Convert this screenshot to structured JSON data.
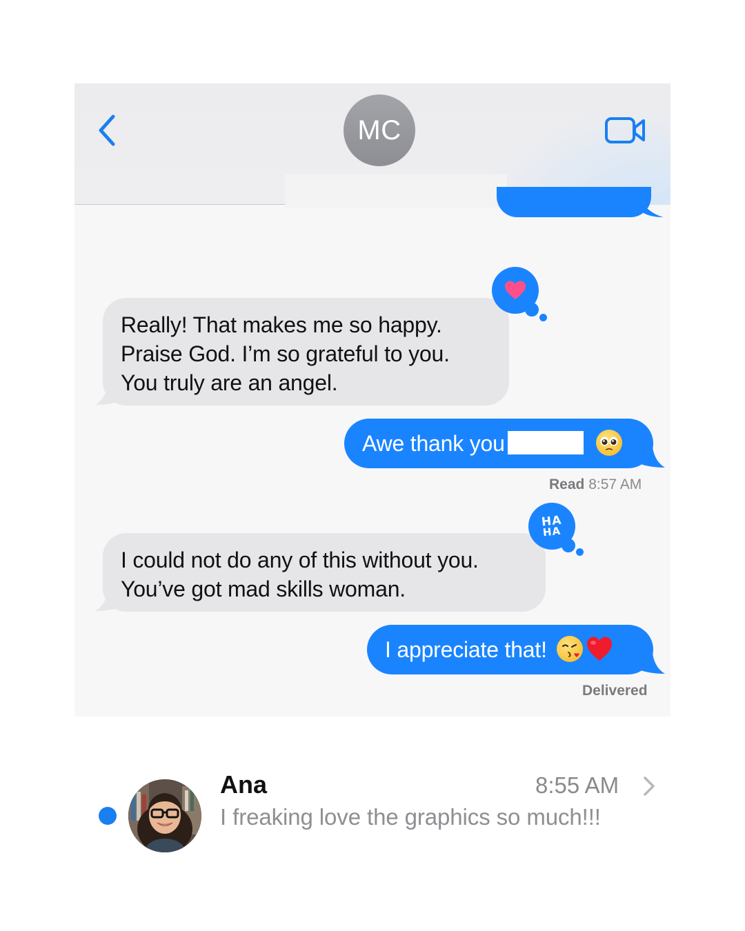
{
  "header": {
    "contact_initials": "MC",
    "back_icon": "chevron-left-icon",
    "video_icon": "video-camera-icon",
    "accent_color": "#1a84ff"
  },
  "messages": [
    {
      "direction": "incoming",
      "lines": [
        "Really! That makes me so happy.",
        "Praise God. I’m so grateful to you.",
        "You truly are an angel."
      ],
      "tapback": "heart"
    },
    {
      "direction": "outgoing",
      "text": "Awe thank you",
      "emoji": "pleading-face-emoji"
    },
    {
      "direction": "incoming",
      "lines": [
        "I could not do any of this without you.",
        "You’ve got mad skills woman."
      ],
      "tapback": "haha",
      "tapback_text": [
        "HA",
        "HA"
      ]
    },
    {
      "direction": "outgoing",
      "text": "I appreciate that!",
      "emoji": [
        "kissing-face-emoji",
        "red-heart-emoji"
      ]
    }
  ],
  "status": {
    "read_label": "Read",
    "read_time": "8:57 AM",
    "delivered": "Delivered"
  },
  "notification": {
    "name": "Ana",
    "time": "8:55 AM",
    "preview": "I freaking love the graphics so much!!!",
    "unread_color": "#1a7ff0"
  }
}
